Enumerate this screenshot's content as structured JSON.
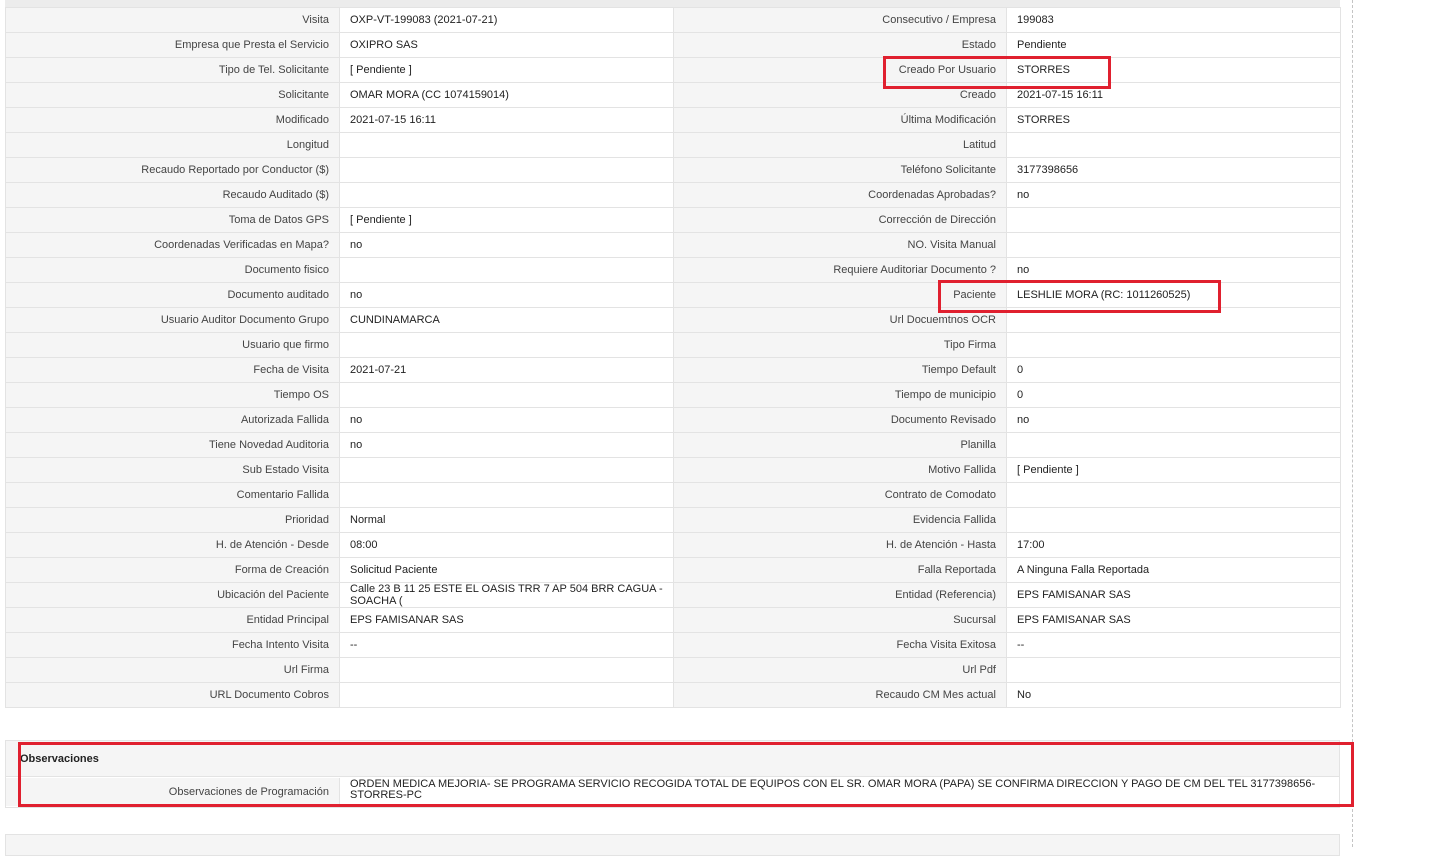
{
  "rows": [
    {
      "l1": "Visita",
      "v1": "OXP-VT-199083 (2021-07-21)",
      "l2": "Consecutivo / Empresa",
      "v2": "199083"
    },
    {
      "l1": "Empresa que Presta el Servicio",
      "v1": "OXIPRO SAS",
      "l2": "Estado",
      "v2": "Pendiente"
    },
    {
      "l1": "Tipo de Tel. Solicitante",
      "v1": "[ Pendiente ]",
      "l2": "Creado Por Usuario",
      "v2": "STORRES"
    },
    {
      "l1": "Solicitante",
      "v1": "OMAR MORA (CC 1074159014)",
      "l2": "Creado",
      "v2": "2021-07-15 16:11"
    },
    {
      "l1": "Modificado",
      "v1": "2021-07-15 16:11",
      "l2": "Última Modificación",
      "v2": " STORRES"
    },
    {
      "l1": "Longitud",
      "v1": "",
      "l2": "Latitud",
      "v2": ""
    },
    {
      "l1": "Recaudo Reportado por Conductor ($)",
      "v1": "",
      "l2": "Teléfono Solicitante",
      "v2": "3177398656"
    },
    {
      "l1": "Recaudo Auditado ($)",
      "v1": "",
      "l2": "Coordenadas Aprobadas?",
      "v2": " no"
    },
    {
      "l1": "Toma de Datos GPS",
      "v1": "[ Pendiente ]",
      "l2": "Corrección de Dirección",
      "v2": ""
    },
    {
      "l1": "Coordenadas Verificadas en Mapa?",
      "v1": " no",
      "l2": "NO. Visita Manual",
      "v2": ""
    },
    {
      "l1": "Documento fisico",
      "v1": "",
      "l2": "Requiere Auditoriar Documento ?",
      "v2": " no"
    },
    {
      "l1": "Documento auditado",
      "v1": " no",
      "l2": "Paciente",
      "v2": "LESHLIE MORA (RC: 1011260525)"
    },
    {
      "l1": "Usuario Auditor Documento Grupo",
      "v1": "CUNDINAMARCA",
      "l2": "Url Docuemtnos OCR",
      "v2": ""
    },
    {
      "l1": "Usuario que firmo",
      "v1": "",
      "l2": "Tipo Firma",
      "v2": ""
    },
    {
      "l1": "Fecha de Visita",
      "v1": " 2021-07-21",
      "l2": "Tiempo Default",
      "v2": "0"
    },
    {
      "l1": "Tiempo OS",
      "v1": "",
      "l2": "Tiempo de municipio",
      "v2": "0"
    },
    {
      "l1": "Autorizada Fallida",
      "v1": " no",
      "l2": "Documento Revisado",
      "v2": " no"
    },
    {
      "l1": "Tiene Novedad Auditoria",
      "v1": " no",
      "l2": "Planilla",
      "v2": ""
    },
    {
      "l1": "Sub Estado Visita",
      "v1": "",
      "l2": "Motivo Fallida",
      "v2": "[ Pendiente ]"
    },
    {
      "l1": "Comentario Fallida",
      "v1": "",
      "l2": "Contrato de Comodato",
      "v2": ""
    },
    {
      "l1": "Prioridad",
      "v1": "Normal",
      "l2": "Evidencia Fallida",
      "v2": ""
    },
    {
      "l1": "H. de Atención - Desde",
      "v1": "08:00",
      "l2": "H. de Atención - Hasta",
      "v2": "17:00"
    },
    {
      "l1": "Forma de Creación",
      "v1": "Solicitud Paciente",
      "l2": "Falla Reportada",
      "v2": "A Ninguna Falla Reportada"
    },
    {
      "l1": "Ubicación del Paciente",
      "v1": "Calle 23 B 11 25 ESTE EL OASIS TRR 7 AP 504 BRR CAGUA - SOACHA (",
      "l2": "Entidad (Referencia)",
      "v2": "EPS FAMISANAR SAS"
    },
    {
      "l1": "Entidad Principal",
      "v1": "EPS FAMISANAR SAS",
      "l2": "Sucursal",
      "v2": "EPS FAMISANAR SAS"
    },
    {
      "l1": "Fecha Intento Visita",
      "v1": " --",
      "l2": "Fecha Visita Exitosa",
      "v2": " --"
    },
    {
      "l1": "Url Firma",
      "v1": "",
      "l2": "Url Pdf",
      "v2": ""
    },
    {
      "l1": "URL Documento Cobros",
      "v1": "",
      "l2": "Recaudo CM Mes actual",
      "v2": "No"
    }
  ],
  "observaciones": {
    "title": "Observaciones",
    "label": "Observaciones de Programación",
    "value": " ORDEN MEDICA MEJORIA- SE PROGRAMA SERVICIO RECOGIDA TOTAL DE EQUIPOS CON EL SR. OMAR MORA (PAPA) SE CONFIRMA DIRECCION Y PAGO DE CM DEL TEL 3177398656-STORRES-PC"
  },
  "highlight_color": "#e0202f"
}
